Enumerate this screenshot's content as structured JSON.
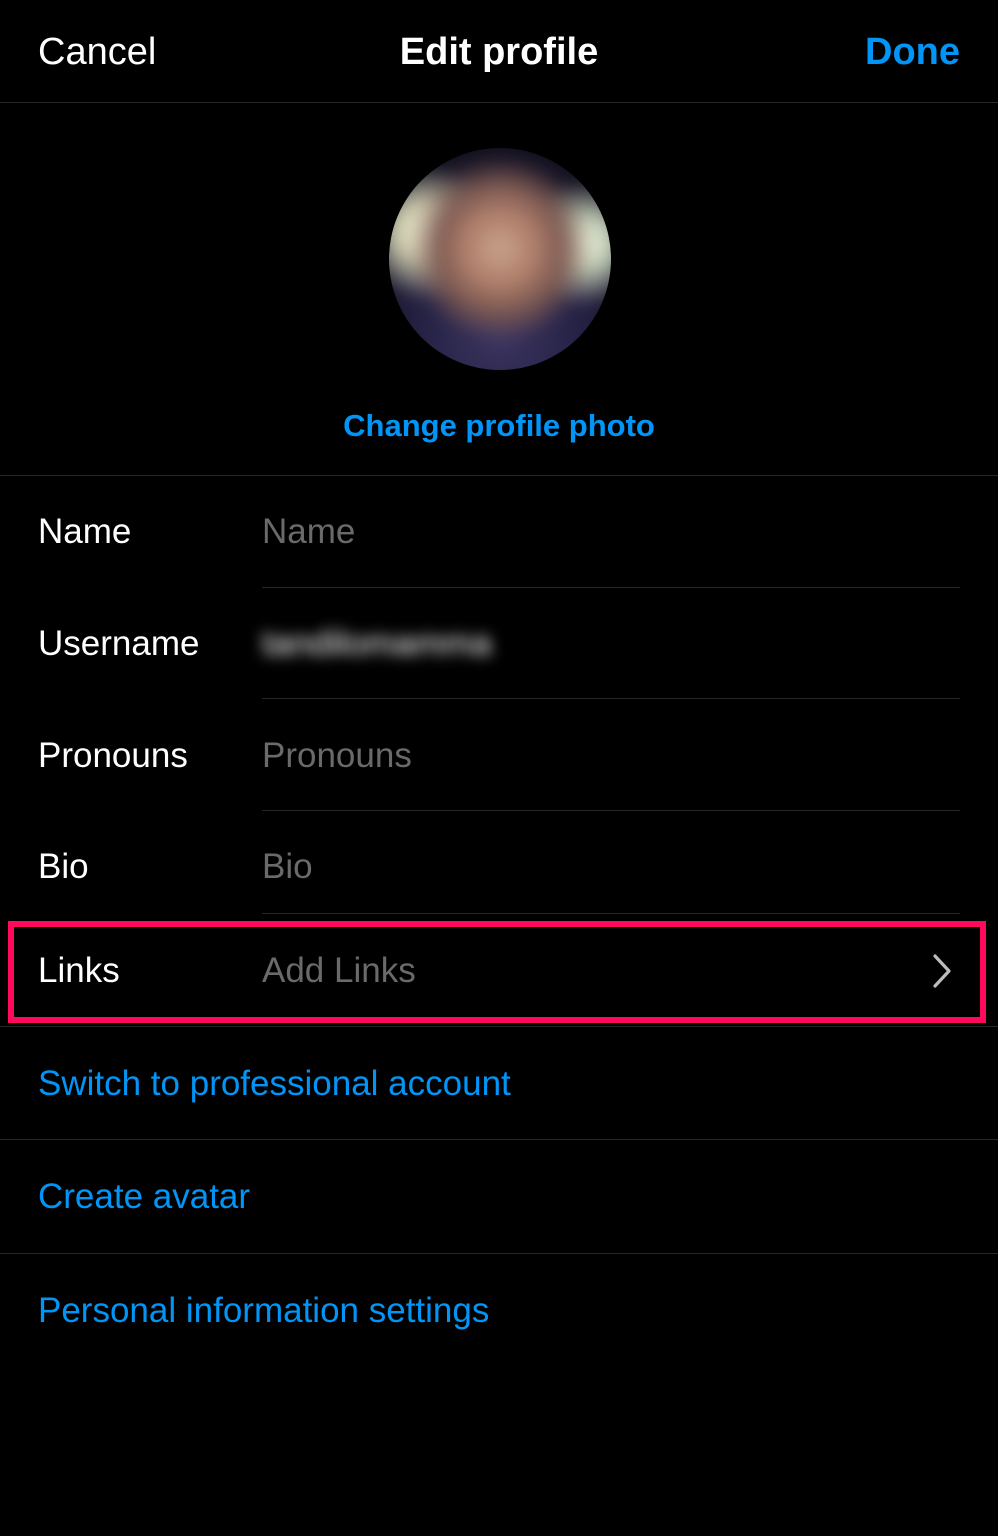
{
  "header": {
    "cancel_label": "Cancel",
    "title": "Edit profile",
    "done_label": "Done"
  },
  "profile_photo": {
    "change_label": "Change profile photo"
  },
  "fields": {
    "name": {
      "label": "Name",
      "placeholder": "Name",
      "value": ""
    },
    "username": {
      "label": "Username",
      "value": "tandilomamma"
    },
    "pronouns": {
      "label": "Pronouns",
      "placeholder": "Pronouns",
      "value": ""
    },
    "bio": {
      "label": "Bio",
      "placeholder": "Bio",
      "value": ""
    },
    "links": {
      "label": "Links",
      "placeholder": "Add Links"
    }
  },
  "actions": {
    "switch_professional": "Switch to professional account",
    "create_avatar": "Create avatar",
    "personal_info": "Personal information settings"
  },
  "colors": {
    "accent": "#0095f6",
    "highlight": "#ff0a5c",
    "background": "#000000",
    "placeholder": "#6a6a6a"
  },
  "icons": {
    "links_chevron": "chevron-right-icon"
  }
}
